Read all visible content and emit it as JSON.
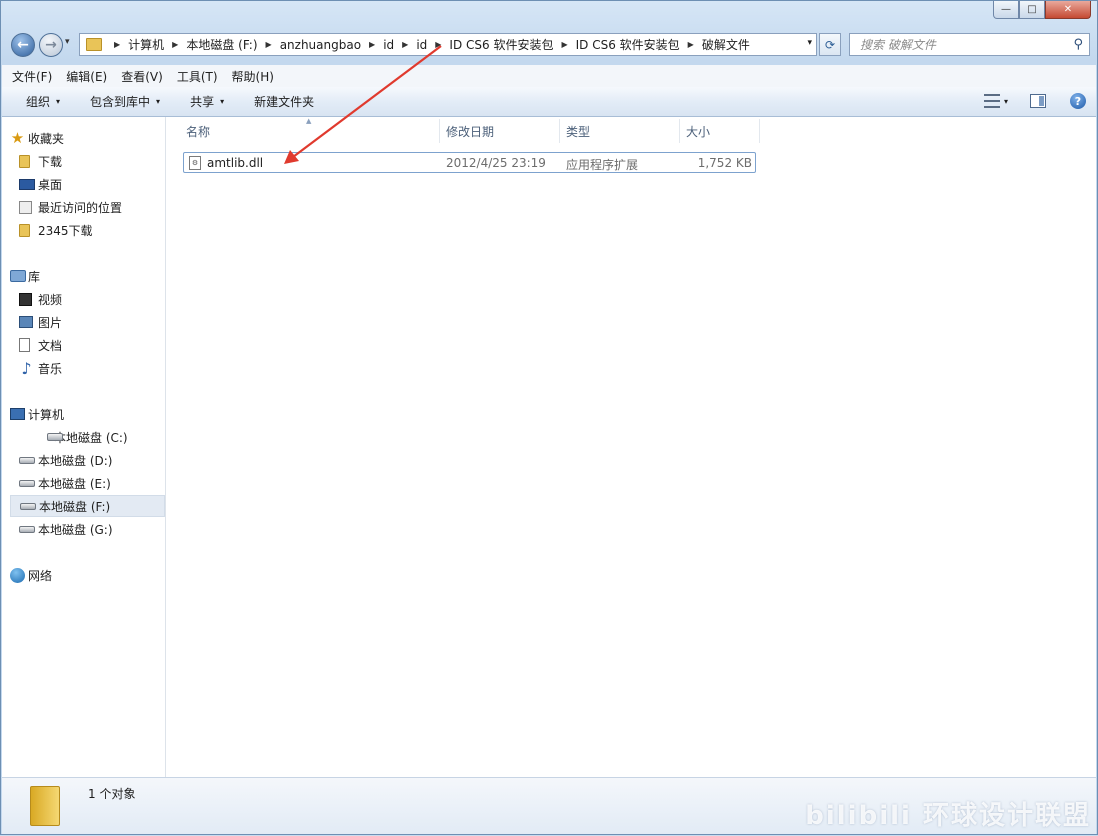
{
  "window": {
    "caption_buttons": {
      "minimize": "—",
      "maximize": "□",
      "close": "✕"
    }
  },
  "nav": {
    "back": "←",
    "forward": "→",
    "dropdown": "▾"
  },
  "address": {
    "crumbs": [
      "计算机",
      "本地磁盘 (F:)",
      "anzhuangbao",
      "id",
      "id",
      "ID CS6 软件安装包",
      "ID CS6 软件安装包",
      "破解文件"
    ],
    "separator": "▶",
    "dropdown": "▾"
  },
  "refresh": "⟳",
  "search": {
    "placeholder": "搜索 破解文件",
    "icon": "⚲"
  },
  "menubar": [
    "文件(F)",
    "编辑(E)",
    "查看(V)",
    "工具(T)",
    "帮助(H)"
  ],
  "toolbar": {
    "organize": "组织",
    "include_library": "包含到库中",
    "share": "共享",
    "new_folder": "新建文件夹",
    "caret": "▾",
    "help": "?"
  },
  "sidebar": {
    "favorites": {
      "label": "收藏夹",
      "items": [
        "下载",
        "桌面",
        "最近访问的位置",
        "2345下载"
      ]
    },
    "libraries": {
      "label": "库",
      "items": [
        "视频",
        "图片",
        "文档",
        "音乐"
      ]
    },
    "computer": {
      "label": "计算机",
      "items": [
        "本地磁盘 (C:)",
        "本地磁盘 (D:)",
        "本地磁盘 (E:)",
        "本地磁盘 (F:)",
        "本地磁盘 (G:)"
      ],
      "selected_index": 3
    },
    "network": {
      "label": "网络"
    }
  },
  "columns": {
    "name": "名称",
    "date": "修改日期",
    "type": "类型",
    "size": "大小",
    "sort_indicator": "▲"
  },
  "files": [
    {
      "name": "amtlib.dll",
      "date": "2012/4/25 23:19",
      "type": "应用程序扩展",
      "size": "1,752 KB"
    }
  ],
  "status": {
    "text": "1 个对象"
  },
  "watermark": "bilibili 环球设计联盟",
  "colors": {
    "annotation_arrow": "#e03a2e",
    "selection_border": "#7da2ce"
  }
}
